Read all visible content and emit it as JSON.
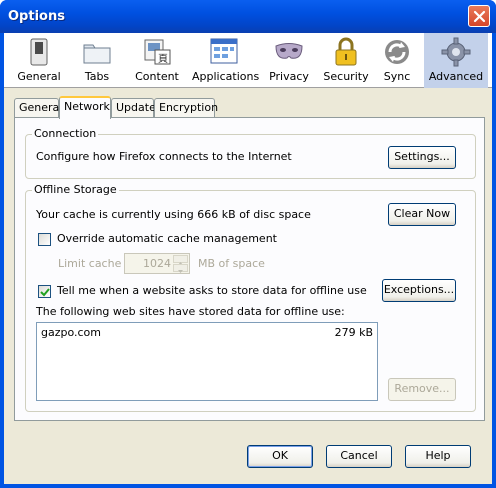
{
  "window": {
    "title": "Options"
  },
  "toolbar": {
    "panes": [
      {
        "label": "General",
        "icon": "switch-icon"
      },
      {
        "label": "Tabs",
        "icon": "folder-tabs-icon"
      },
      {
        "label": "Content",
        "icon": "content-icon"
      },
      {
        "label": "Applications",
        "icon": "applications-icon"
      },
      {
        "label": "Privacy",
        "icon": "mask-icon"
      },
      {
        "label": "Security",
        "icon": "padlock-icon"
      },
      {
        "label": "Sync",
        "icon": "sync-icon"
      },
      {
        "label": "Advanced",
        "icon": "gear-icon"
      }
    ],
    "active": "Advanced"
  },
  "tabs": [
    "General",
    "Network",
    "Update",
    "Encryption"
  ],
  "active_tab": "Network",
  "connection": {
    "caption": "Connection",
    "description": "Configure how Firefox connects to the Internet",
    "settings_button": "Settings..."
  },
  "offline": {
    "caption": "Offline Storage",
    "cache_usage": "Your cache is currently using 666 kB of disc space",
    "clear_now_button": "Clear Now",
    "override_label": "Override automatic cache management",
    "override_checked": false,
    "limit_label": "Limit cache to",
    "limit_value": "1024",
    "limit_unit": "MB of space",
    "tell_me_label": "Tell me when a website asks to store data for offline use",
    "tell_me_checked": true,
    "exceptions_button": "Exceptions...",
    "sites_label": "The following web sites have stored data for offline use:",
    "sites": [
      {
        "site": "gazpo.com",
        "size": "279 kB"
      }
    ],
    "remove_button": "Remove..."
  },
  "footer": {
    "ok": "OK",
    "cancel": "Cancel",
    "help": "Help"
  },
  "colors": {
    "titlebar": "#0054e3",
    "dialog_bg": "#ece9d8",
    "active_pane": "#c3d1ea",
    "active_tab_accent": "#ffc83c"
  }
}
